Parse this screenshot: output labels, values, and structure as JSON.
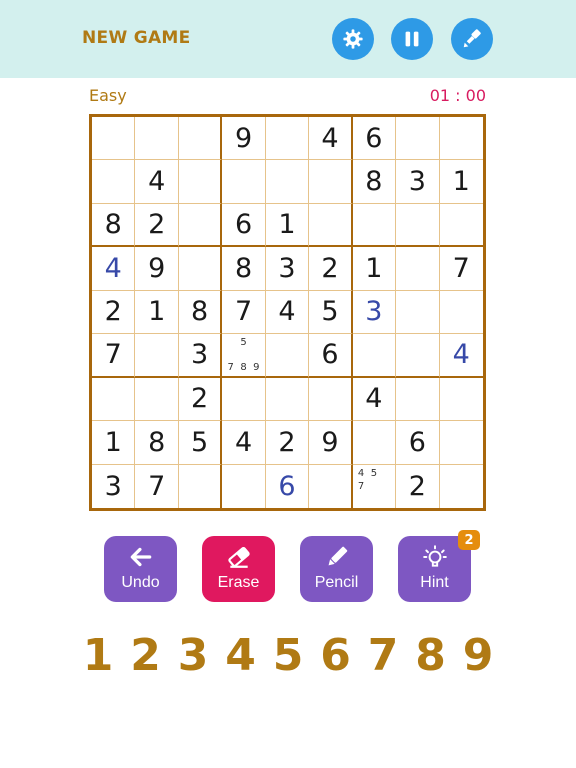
{
  "header": {
    "new_game_label": "NEW GAME"
  },
  "status": {
    "difficulty": "Easy",
    "timer": "01 : 00"
  },
  "icons": {
    "settings": "gear-icon",
    "pause": "pause-icon",
    "theme": "paint-brush-icon",
    "undo": "arrow-left-icon",
    "erase": "eraser-icon",
    "pencil": "pencil-icon",
    "hint": "lightbulb-icon"
  },
  "colors": {
    "accent": "#b07a14",
    "button_blue": "#2e9ae6",
    "button_purple": "#7e57c2",
    "button_pink": "#e0185f",
    "user_digit": "#3749a8",
    "timer": "#d81b60"
  },
  "board": {
    "rows": [
      [
        {
          "v": ""
        },
        {
          "v": ""
        },
        {
          "v": ""
        },
        {
          "v": "9"
        },
        {
          "v": ""
        },
        {
          "v": "4"
        },
        {
          "v": "6"
        },
        {
          "v": ""
        },
        {
          "v": ""
        }
      ],
      [
        {
          "v": ""
        },
        {
          "v": "4"
        },
        {
          "v": ""
        },
        {
          "v": ""
        },
        {
          "v": ""
        },
        {
          "v": ""
        },
        {
          "v": "8"
        },
        {
          "v": "3"
        },
        {
          "v": "1"
        }
      ],
      [
        {
          "v": "8"
        },
        {
          "v": "2"
        },
        {
          "v": ""
        },
        {
          "v": "6"
        },
        {
          "v": "1"
        },
        {
          "v": ""
        },
        {
          "v": ""
        },
        {
          "v": ""
        },
        {
          "v": ""
        }
      ],
      [
        {
          "v": "4",
          "user": true
        },
        {
          "v": "9"
        },
        {
          "v": ""
        },
        {
          "v": "8"
        },
        {
          "v": "3"
        },
        {
          "v": "2"
        },
        {
          "v": "1"
        },
        {
          "v": ""
        },
        {
          "v": "7"
        }
      ],
      [
        {
          "v": "2"
        },
        {
          "v": "1"
        },
        {
          "v": "8"
        },
        {
          "v": "7"
        },
        {
          "v": "4"
        },
        {
          "v": "5"
        },
        {
          "v": "3",
          "user": true
        },
        {
          "v": ""
        },
        {
          "v": ""
        }
      ],
      [
        {
          "v": "7"
        },
        {
          "v": ""
        },
        {
          "v": "3"
        },
        {
          "v": "",
          "notes": [
            "",
            "5",
            "",
            "",
            "",
            "",
            "7",
            "8",
            "9"
          ]
        },
        {
          "v": ""
        },
        {
          "v": "6"
        },
        {
          "v": ""
        },
        {
          "v": ""
        },
        {
          "v": "4",
          "user": true
        }
      ],
      [
        {
          "v": ""
        },
        {
          "v": ""
        },
        {
          "v": "2"
        },
        {
          "v": ""
        },
        {
          "v": ""
        },
        {
          "v": ""
        },
        {
          "v": "4"
        },
        {
          "v": ""
        },
        {
          "v": ""
        }
      ],
      [
        {
          "v": "1"
        },
        {
          "v": "8"
        },
        {
          "v": "5"
        },
        {
          "v": "4"
        },
        {
          "v": "2"
        },
        {
          "v": "9"
        },
        {
          "v": ""
        },
        {
          "v": "6"
        },
        {
          "v": ""
        }
      ],
      [
        {
          "v": "3"
        },
        {
          "v": "7"
        },
        {
          "v": ""
        },
        {
          "v": ""
        },
        {
          "v": "6",
          "user": true
        },
        {
          "v": ""
        },
        {
          "v": "",
          "notes": [
            "4",
            "5",
            "",
            "7",
            "",
            "",
            "",
            "",
            ""
          ]
        },
        {
          "v": "2"
        },
        {
          "v": ""
        }
      ]
    ]
  },
  "actions": {
    "undo": "Undo",
    "erase": "Erase",
    "pencil": "Pencil",
    "hint": "Hint",
    "hint_count": "2"
  },
  "numpad": [
    "1",
    "2",
    "3",
    "4",
    "5",
    "6",
    "7",
    "8",
    "9"
  ]
}
